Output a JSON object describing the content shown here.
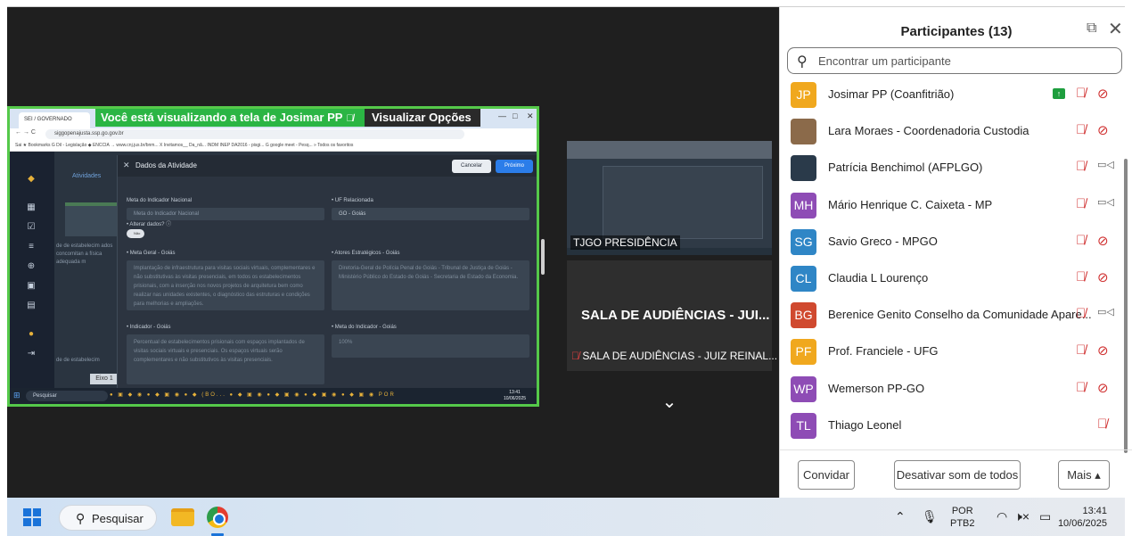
{
  "meeting": {
    "share_banner": "Você está visualizando a tela de  Josimar PP",
    "share_options": "Visualizar Opções",
    "tile_top_label": "TJGO PRESIDÊNCIA",
    "tile_mid_name": "SALA DE AUDIÊNCIAS - JUI...",
    "tile_mid_label": "SALA DE AUDIÊNCIAS - JUIZ REINAL..."
  },
  "shared_screen": {
    "tab_title": "SEI / GOVERNADO",
    "url": "siggopenajusta.ssp.go.gov.br",
    "bookmarks": "Sai  ★ Bookmarks  G  Dil - Legislação  ◆ ENCCIA  → www.cnj.jus.br/bnm...  X Invitamos__ Da_nã...  INDM  INEP DA2016 - pisgi...  G google meet - Pesq...  »  Todos os favoritos",
    "atividades": "Atividades",
    "left_text": "de de estabelecim ados concomitan a física adequada m",
    "left_text_2": "de de estabelecim",
    "eixo": "Eixo 1",
    "modal": {
      "title": "Dados da Atividade",
      "cancel": "Cancelar",
      "next": "Próximo",
      "meta_indicador_nacional_label": "Meta do Indicador Nacional",
      "meta_indicador_nacional_placeholder": "Meta do Indicador Nacional",
      "uf_label": "• UF Relacionada",
      "uf_value": "GO - Goiás",
      "alterar_label": "• Alterar dados? ⓘ",
      "toggle_text": "Não",
      "meta_geral_label": "• Meta Geral - Goiás",
      "meta_geral_text": "Implantação de infraestrutura para visitas sociais virtuais, complementares e não substitutivas às visitas presenciais, em todos os estabelecimentos prisionais, com a inserção nos novos projetos de arquitetura bem como realizar nas unidades existentes, o diagnóstico das estruturas e condições para melhorias e ampliações.",
      "atores_label": "• Atores Estratégicos - Goiás",
      "atores_text": "Diretoria-Geral de Polícia Penal de Goiás - Tribunal de Justiça de Goiás - Ministério Público do Estado de Goiás - Secretaria de Estado da Economia.",
      "indicador_label": "• Indicador - Goiás",
      "indicador_text": "Percentual de estabelecimentos prisionais com espaços implantados de visitas sociais virtuais e presenciais. Os espaços virtuais serão complementares e não substitutivos às visitas presenciais.",
      "meta_indicador_label": "• Meta do Indicador - Goiás",
      "meta_indicador_value": "100%"
    },
    "taskbar_search": "Pesquisar",
    "taskbar_icons": "● ▣ ◆ ◉ ● ◆ ▣ ◉ ● ◆ (BO... ● ◆ ▣ ◉ ● ◆ ▣ ◉ ● ◆ ▣ ◉ ● ◆ ▣ ◉ POR",
    "clock_time": "13:41",
    "clock_date": "10/06/2025"
  },
  "panel": {
    "title": "Participantes (13)",
    "search_placeholder": "Encontrar um participante",
    "participants": [
      {
        "initials": "JP",
        "name": "Josimar PP (Coanfitrião)",
        "color": "#f0a81e",
        "sharing": true,
        "mic_muted": true,
        "cam": "off"
      },
      {
        "initials": "",
        "name": "Lara Moraes - Coordenadoria Custodia",
        "color": "#8b6a4a",
        "photo": true,
        "sharing": false,
        "mic_muted": true,
        "cam": "off"
      },
      {
        "initials": "",
        "name": "Patrícia Benchimol (AFPLGO)",
        "color": "#2a3a4a",
        "photo": true,
        "sharing": false,
        "mic_muted": true,
        "cam": "on"
      },
      {
        "initials": "MH",
        "name": "Mário Henrique C. Caixeta - MP",
        "color": "#8e4cb5",
        "sharing": false,
        "mic_muted": true,
        "cam": "on"
      },
      {
        "initials": "SG",
        "name": "Savio Greco - MPGO",
        "color": "#2f86c6",
        "sharing": false,
        "mic_muted": true,
        "cam": "off"
      },
      {
        "initials": "CL",
        "name": "Claudia L Lourenço",
        "color": "#2f86c6",
        "sharing": false,
        "mic_muted": true,
        "cam": "off"
      },
      {
        "initials": "BG",
        "name": "Berenice Genito Conselho da Comunidade Apare...",
        "color": "#d0492f",
        "sharing": false,
        "mic_muted": true,
        "cam": "on"
      },
      {
        "initials": "PF",
        "name": "Prof. Franciele - UFG",
        "color": "#f0a81e",
        "sharing": false,
        "mic_muted": true,
        "cam": "off"
      },
      {
        "initials": "WP",
        "name": "Wemerson PP-GO",
        "color": "#8e4cb5",
        "sharing": false,
        "mic_muted": true,
        "cam": "off"
      },
      {
        "initials": "TL",
        "name": "Thiago Leonel",
        "color": "#8e4cb5",
        "sharing": false,
        "mic_muted": true,
        "cam": "none"
      }
    ],
    "invite": "Convidar",
    "mute_all": "Desativar som de todos",
    "more": "Mais ▴"
  },
  "taskbar": {
    "search": "Pesquisar",
    "lang_1": "POR",
    "lang_2": "PTB2",
    "time": "13:41",
    "date": "10/06/2025"
  },
  "colors": {
    "share_border": "#55c94a",
    "share_banner": "#2bb544",
    "muted_red": "#d03030",
    "accent_blue": "#2b7de9"
  }
}
